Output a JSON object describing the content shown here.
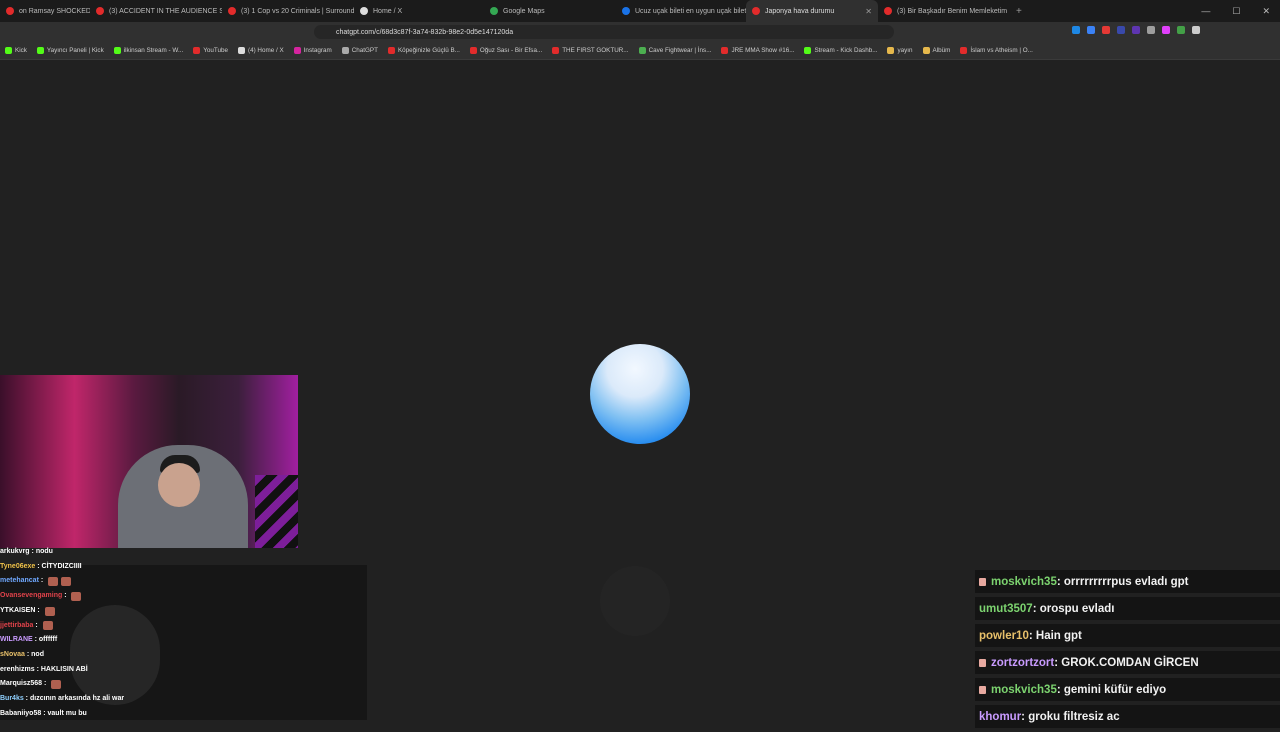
{
  "tabs": [
    {
      "title": "on Ramsay SHOCKED By Th",
      "favicon_color": "#e22b2b",
      "active": false
    },
    {
      "title": "(3) ACCIDENT IN THE AUDIENCE STA",
      "favicon_color": "#e22b2b",
      "active": false
    },
    {
      "title": "(3) 1 Cop vs 20 Criminals | Surrounde",
      "favicon_color": "#e22b2b",
      "active": false
    },
    {
      "title": "Home / X",
      "favicon_color": "#dddddd",
      "active": false
    },
    {
      "title": "Google Maps",
      "favicon_color": "#34a853",
      "active": false
    },
    {
      "title": "Ucuz uçak bileti en uygun uçak bileti",
      "favicon_color": "#1a73e8",
      "active": false
    },
    {
      "title": "Japonya hava durumu",
      "favicon_color": "#e22b2b",
      "active": true
    },
    {
      "title": "(3) Bir Başkadır Benim Memleketim",
      "favicon_color": "#e22b2b",
      "active": false
    }
  ],
  "address_bar": {
    "url": "chatgpt.com/c/68d3c87f-3a74-832b-98e2-0d5e147120da"
  },
  "bookmarks": [
    {
      "label": "Kick",
      "color": "#53fc18"
    },
    {
      "label": "Yayıncı Paneli | Kick",
      "color": "#53fc18"
    },
    {
      "label": "ilkinsan Stream - W...",
      "color": "#53fc18"
    },
    {
      "label": "YouTube",
      "color": "#e22b2b"
    },
    {
      "label": "(4) Home / X",
      "color": "#dddddd"
    },
    {
      "label": "Instagram",
      "color": "#d6249f"
    },
    {
      "label": "ChatGPT",
      "color": "#aaaaaa"
    },
    {
      "label": "Köpeğinizle Güçlü B...",
      "color": "#e22b2b"
    },
    {
      "label": "Oğuz Sası - Bir Efsa...",
      "color": "#e22b2b"
    },
    {
      "label": "THE FIRST GOKTUR...",
      "color": "#e22b2b"
    },
    {
      "label": "Cave Fightwear | İns...",
      "color": "#4caf50"
    },
    {
      "label": "JRE MMA Show #16...",
      "color": "#e22b2b"
    },
    {
      "label": "Stream - Kick Dashb...",
      "color": "#53fc18"
    },
    {
      "label": "yayın",
      "color": "#e6b84c"
    },
    {
      "label": "Albüm",
      "color": "#e6b84c"
    },
    {
      "label": "İslam vs Atheism | O...",
      "color": "#e22b2b"
    }
  ],
  "left_chat": [
    {
      "user": "arkukvrg",
      "msg": "nodu",
      "color": "#ffffff",
      "emotes": 0
    },
    {
      "user": "Tyne06exe",
      "msg": "CİTYDIZCIIII",
      "color": "#f0c24a",
      "emotes": 0
    },
    {
      "user": "metehancat",
      "msg": "",
      "color": "#6fa8ff",
      "emotes": 2
    },
    {
      "user": "Ovansevengaming",
      "msg": "",
      "color": "#e0424a",
      "emotes": 1
    },
    {
      "user": "YTKAISEN",
      "msg": "",
      "color": "#ffffff",
      "emotes": 1
    },
    {
      "user": "jjettirbaba",
      "msg": "",
      "color": "#e0424a",
      "emotes": 1
    },
    {
      "user": "WILRANE",
      "msg": "offffff",
      "color": "#c99bff",
      "emotes": 0
    },
    {
      "user": "sNovaa",
      "msg": "nod",
      "color": "#e8c06a",
      "emotes": 0
    },
    {
      "user": "erenhizms",
      "msg": "HAKLISIN ABİ",
      "color": "#ffffff",
      "emotes": 0
    },
    {
      "user": "Marquisz568",
      "msg": "",
      "color": "#ffffff",
      "emotes": 1
    },
    {
      "user": "Bur4ks",
      "msg": "dızcının arkasında hz ali war",
      "color": "#8fd0ff",
      "emotes": 0
    },
    {
      "user": "Babaniiyo58",
      "msg": "vault mu bu",
      "color": "#ffffff",
      "emotes": 0
    }
  ],
  "right_chat": [
    {
      "user": "moskvich35",
      "msg": "orrrrrrrrrpus evladı gpt",
      "color": "#7cd36f",
      "badge": true
    },
    {
      "user": "umut3507",
      "msg": "orospu evladı",
      "color": "#7cd36f",
      "badge": false
    },
    {
      "user": "powler10",
      "msg": "Hain gpt",
      "color": "#e8c06a",
      "badge": false
    },
    {
      "user": "zortzortzort",
      "msg": "GROK.COMDAN GİRCEN",
      "color": "#c99bff",
      "badge": true
    },
    {
      "user": "moskvich35",
      "msg": "gemini küfür ediyo",
      "color": "#7cd36f",
      "badge": true
    },
    {
      "user": "khomur",
      "msg": "groku filtresiz ac",
      "color": "#c99bff",
      "badge": false
    }
  ]
}
